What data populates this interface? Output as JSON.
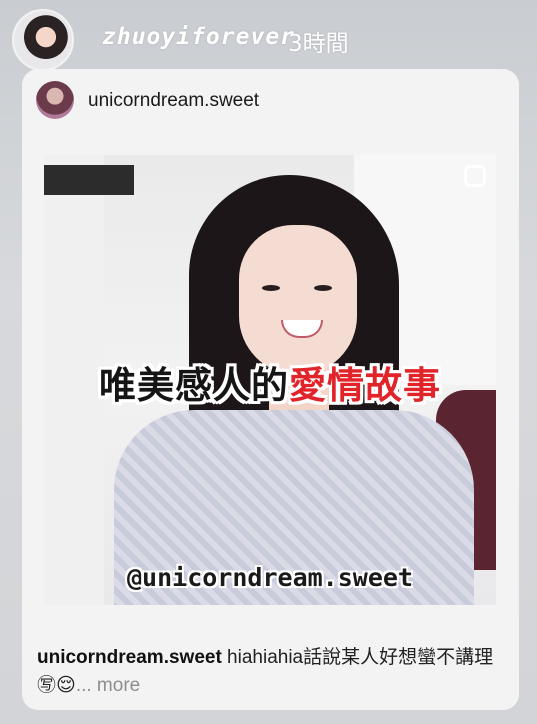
{
  "story": {
    "username": "zhuoyiforever",
    "time": "3時間"
  },
  "post": {
    "username": "unicorndream.sweet",
    "image": {
      "title_black": "唯美感人的",
      "title_red": "愛情故事",
      "watermark": "@unicorndream.sweet"
    },
    "caption": {
      "username": "unicorndream.sweet",
      "text": " hiahiahia話說某人好想蠻不講理㊢😌",
      "more": "... more"
    }
  },
  "icons": {
    "story_avatar": "profile-photo",
    "post_avatar": "profile-photo",
    "corner": "multi-post-icon"
  },
  "colors": {
    "accent_red": "#e0242a"
  }
}
